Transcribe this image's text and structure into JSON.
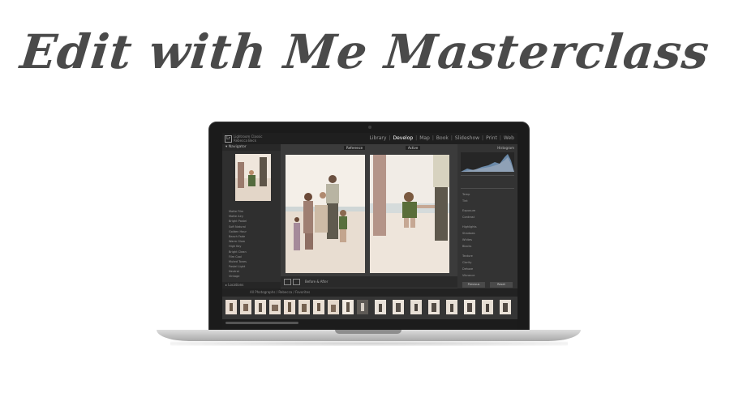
{
  "title": "Edit with Me Masterclass",
  "app": {
    "catalog_line1": "Lightroom Classic",
    "catalog_line2": "Rebecca Beck",
    "modules": [
      "Library",
      "Develop",
      "Map",
      "Book",
      "Slideshow",
      "Print",
      "Web"
    ],
    "active_module": "Develop"
  },
  "left_panel": {
    "navigator_label": "Navigator",
    "presets": [
      "Matte Film",
      "Matte Airy",
      "Bright Pastel",
      "Soft Natural",
      "Golden Hour",
      "Beach Fade",
      "Warm Glow",
      "High Key",
      "Bright Clean",
      "Film Cool",
      "Muted Tones",
      "Pastel Light",
      "Neutral",
      "Vintage",
      "Beach Matte"
    ],
    "locations_label": "Locations"
  },
  "center": {
    "before_tab": "Reference",
    "after_tab": "Active",
    "toolbar_text": "Before & After"
  },
  "right_panel": {
    "histogram_label": "Histogram",
    "sliders": [
      "Temp",
      "Tint",
      "Exposure",
      "Contrast",
      "Highlights",
      "Shadows",
      "Whites",
      "Blacks",
      "Texture",
      "Clarity",
      "Dehaze",
      "Vibrance"
    ],
    "previous_button": "Previous",
    "reset_button": "Reset"
  },
  "filmstrip": {
    "text": "All Photographs / Rebecca / Favorites"
  },
  "colors": {
    "title": "#4a4a4a",
    "ui_dark": "#2b2b2b",
    "sand": "#e9ddd2",
    "sky": "#f2eee9"
  }
}
